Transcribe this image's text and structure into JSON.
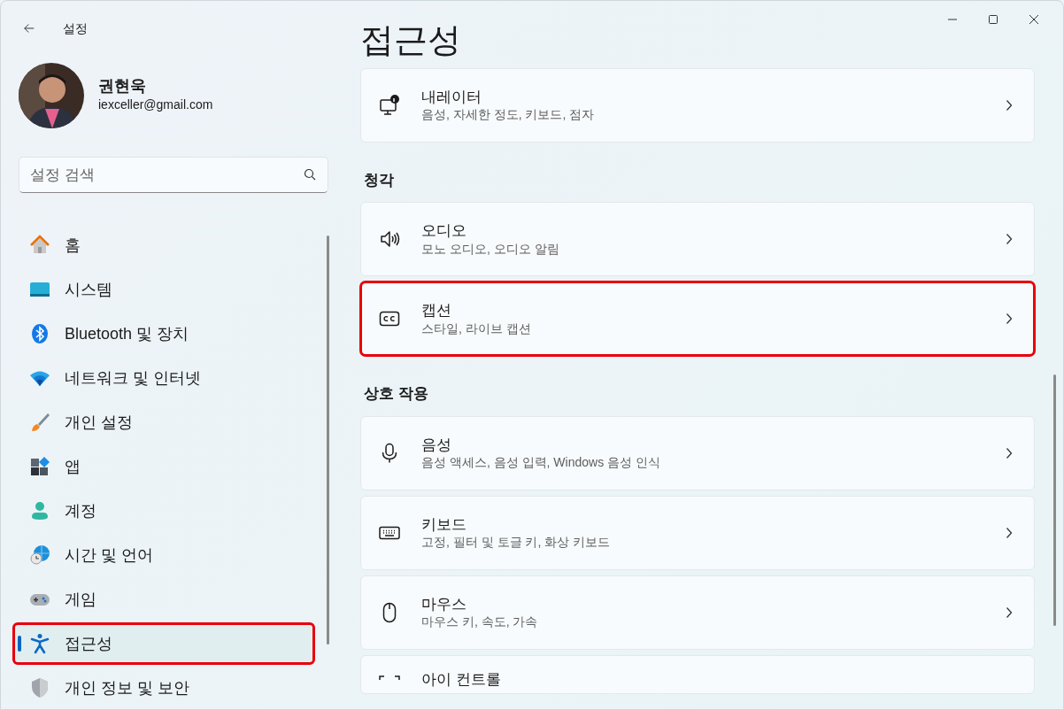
{
  "window": {
    "title": "설정"
  },
  "profile": {
    "name": "권현욱",
    "email": "iexceller@gmail.com"
  },
  "search": {
    "placeholder": "설정 검색"
  },
  "sidebar": {
    "items": [
      {
        "kind": "home",
        "label": "홈",
        "selected": false,
        "highlighted": false
      },
      {
        "kind": "system",
        "label": "시스템",
        "selected": false,
        "highlighted": false
      },
      {
        "kind": "bluetooth",
        "label": "Bluetooth 및 장치",
        "selected": false,
        "highlighted": false
      },
      {
        "kind": "network",
        "label": "네트워크 및 인터넷",
        "selected": false,
        "highlighted": false
      },
      {
        "kind": "brush",
        "label": "개인 설정",
        "selected": false,
        "highlighted": false
      },
      {
        "kind": "apps",
        "label": "앱",
        "selected": false,
        "highlighted": false
      },
      {
        "kind": "account",
        "label": "계정",
        "selected": false,
        "highlighted": false
      },
      {
        "kind": "time",
        "label": "시간 및 언어",
        "selected": false,
        "highlighted": false
      },
      {
        "kind": "game",
        "label": "게임",
        "selected": false,
        "highlighted": false
      },
      {
        "kind": "accessibility",
        "label": "접근성",
        "selected": true,
        "highlighted": true
      },
      {
        "kind": "shield",
        "label": "개인 정보 및 보안",
        "selected": false,
        "highlighted": false
      }
    ]
  },
  "page": {
    "title": "접근성",
    "sections": [
      {
        "cards": [
          {
            "kind": "narrator",
            "title": "내레이터",
            "subtitle": "음성, 자세한 정도, 키보드, 점자",
            "highlighted": false
          }
        ]
      },
      {
        "heading": "청각",
        "cards": [
          {
            "kind": "audio",
            "title": "오디오",
            "subtitle": "모노 오디오, 오디오 알림",
            "highlighted": false
          },
          {
            "kind": "captions",
            "title": "캡션",
            "subtitle": "스타일, 라이브 캡션",
            "highlighted": true
          }
        ]
      },
      {
        "heading": "상호 작용",
        "cards": [
          {
            "kind": "speech",
            "title": "음성",
            "subtitle": "음성 액세스, 음성 입력, Windows 음성 인식",
            "highlighted": false
          },
          {
            "kind": "keyboard",
            "title": "키보드",
            "subtitle": "고정, 필터 및 토글 키, 화상 키보드",
            "highlighted": false
          },
          {
            "kind": "mouse",
            "title": "마우스",
            "subtitle": "마우스 키, 속도, 가속",
            "highlighted": false
          },
          {
            "kind": "eye",
            "title": "아이 컨트롤",
            "highlighted": false
          }
        ]
      }
    ]
  }
}
